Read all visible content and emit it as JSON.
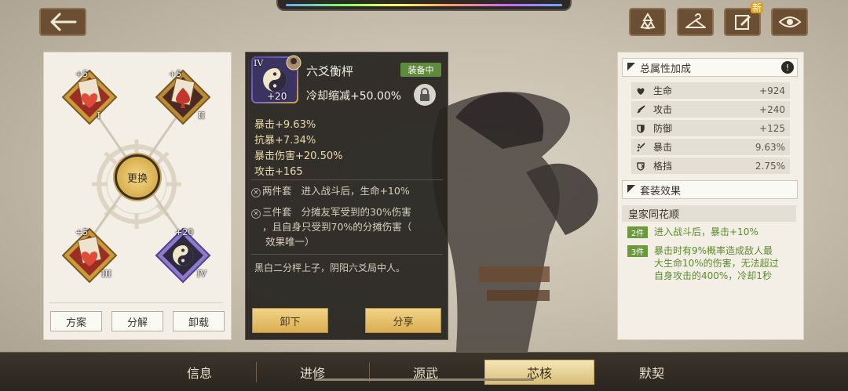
{
  "header": {
    "back_icon": "arrow-left-icon",
    "actions": [
      {
        "icon": "recycle-icon"
      },
      {
        "icon": "hanger-icon"
      },
      {
        "icon": "edit-note-icon",
        "badge": "新"
      },
      {
        "icon": "eye-icon"
      }
    ]
  },
  "left_panel": {
    "slots": [
      {
        "level": "+5",
        "roman": "I",
        "suit": "heart"
      },
      {
        "level": "+5",
        "roman": "II",
        "suit": "spade"
      },
      {
        "level": "+5",
        "roman": "III",
        "suit": "heart"
      },
      {
        "level": "+20",
        "roman": "IV",
        "suit": "yinyang"
      }
    ],
    "center_label": "更换",
    "buttons": {
      "plan": "方案",
      "decompose": "分解",
      "unequip": "卸载"
    }
  },
  "item_popup": {
    "slot_roman": "IV",
    "level": "+20",
    "name": "六爻衡枰",
    "equipped_label": "装备中",
    "main_stat": "冷却缩减+50.00%",
    "sub_stats": [
      "暴击+9.63%",
      "抗暴+7.34%",
      "暴击伤害+20.50%",
      "攻击+165"
    ],
    "set_effects": [
      {
        "tier": "两件套",
        "text": "进入战斗后，生命+10%"
      },
      {
        "tier": "三件套",
        "text_lines": [
          "分摊友军受到的30%伤害",
          "，且自身只受到70%的分摊伤害（",
          "效果唯一）"
        ]
      }
    ],
    "flavor": "黑白二分枰上子，阴阳六爻局中人。",
    "buttons": {
      "unequip": "卸下",
      "share": "分享"
    }
  },
  "right_panel": {
    "total_title": "总属性加成",
    "info_label": "!",
    "stats": [
      {
        "icon": "heart-icon",
        "name": "生命",
        "value": "+924"
      },
      {
        "icon": "sword-icon",
        "name": "攻击",
        "value": "+240"
      },
      {
        "icon": "shield-icon",
        "name": "防御",
        "value": "+125"
      },
      {
        "icon": "crit-icon",
        "name": "暴击",
        "value": "9.63%"
      },
      {
        "icon": "block-icon",
        "name": "格挡",
        "value": "2.75%"
      }
    ],
    "set_title": "套装效果",
    "set_name": "皇家同花顺",
    "set_bonuses": [
      {
        "badge": "2件",
        "lines": [
          "进入战斗后，暴击+10%"
        ]
      },
      {
        "badge": "3件",
        "lines": [
          "暴击时有9%概率造成敌人最",
          "大生命10%的伤害，无法超过",
          "自身攻击的400%，冷却1秒"
        ]
      }
    ]
  },
  "bottom_nav": {
    "tabs": [
      {
        "label": "信息",
        "active": false
      },
      {
        "label": "进修",
        "active": false
      },
      {
        "label": "源武",
        "active": false
      },
      {
        "label": "芯核",
        "active": true
      },
      {
        "label": "默契",
        "active": false
      }
    ]
  },
  "colors": {
    "accent_gold": "#d9ad52",
    "equipped_green": "#5f8b3c",
    "set_green": "#5c8b2c",
    "crit_text": "#e9d9a9"
  }
}
